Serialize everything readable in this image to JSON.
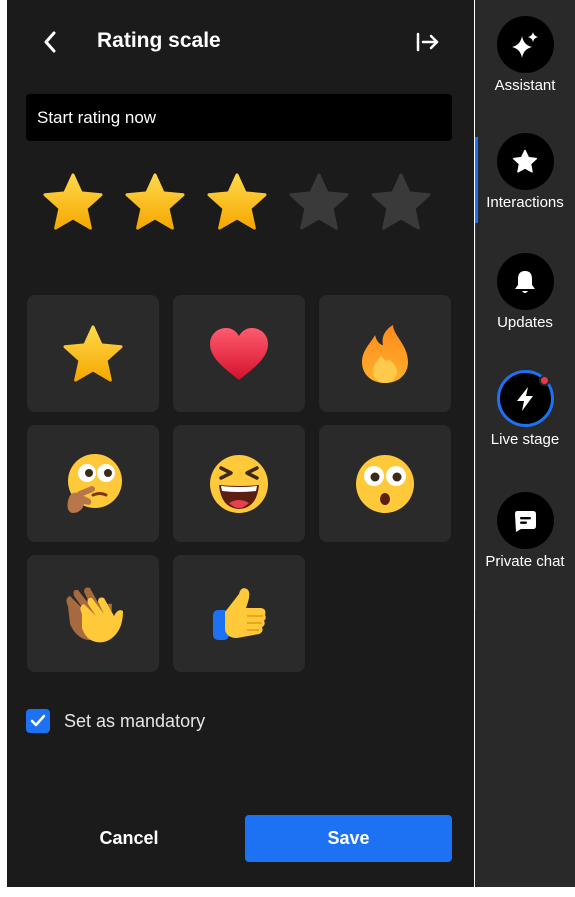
{
  "header": {
    "title": "Rating scale",
    "back_icon": "chevron-left-icon",
    "collapse_icon": "arrow-right-to-line-icon"
  },
  "prompt": {
    "value": "Start rating now"
  },
  "rating_preview": {
    "max": 5,
    "filled": 3,
    "icon": "star-icon"
  },
  "icon_options": [
    {
      "name": "star",
      "selected": true
    },
    {
      "name": "heart",
      "selected": false
    },
    {
      "name": "fire",
      "selected": false
    },
    {
      "name": "thinking-face",
      "selected": false
    },
    {
      "name": "laughing-face",
      "selected": false
    },
    {
      "name": "surprised-face",
      "selected": false
    },
    {
      "name": "clapping-hands",
      "selected": false
    },
    {
      "name": "thumbs-up",
      "selected": false
    }
  ],
  "mandatory": {
    "label": "Set as mandatory",
    "checked": true
  },
  "actions": {
    "cancel_label": "Cancel",
    "save_label": "Save"
  },
  "sidebar": {
    "items": [
      {
        "label": "Assistant",
        "icon": "sparkle-icon"
      },
      {
        "label": "Interactions",
        "icon": "star-icon",
        "active": true
      },
      {
        "label": "Updates",
        "icon": "bell-icon"
      },
      {
        "label": "Live stage",
        "icon": "lightning-icon",
        "notification": true
      },
      {
        "label": "Private chat",
        "icon": "chat-bubble-icon"
      }
    ]
  },
  "colors": {
    "accent": "#1d72f3",
    "panel_bg": "#1b1b1b",
    "rail_bg": "#292929",
    "tile_bg": "#2a2a2a",
    "star_filled": "#ffc72c",
    "star_empty": "#3a3a3a"
  }
}
